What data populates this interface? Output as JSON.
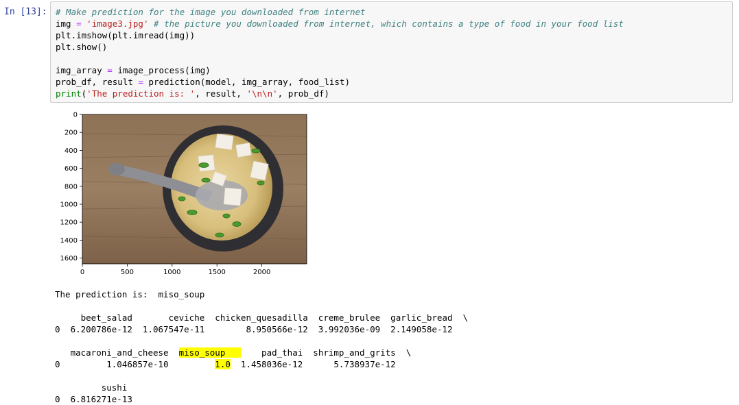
{
  "cell": {
    "prompt": "In [13]:",
    "code_lines": [
      {
        "segments": [
          {
            "t": "# Make prediction for the image you downloaded from internet",
            "c": "cm"
          }
        ]
      },
      {
        "segments": [
          {
            "t": "img ",
            "c": ""
          },
          {
            "t": "=",
            "c": "op"
          },
          {
            "t": " ",
            "c": ""
          },
          {
            "t": "'image3.jpg'",
            "c": "str"
          },
          {
            "t": " ",
            "c": ""
          },
          {
            "t": "# the picture you downloaded from internet, which contains a type of food in your food list",
            "c": "cm"
          }
        ]
      },
      {
        "segments": [
          {
            "t": "plt.imshow(plt.imread(img))",
            "c": ""
          }
        ]
      },
      {
        "segments": [
          {
            "t": "plt.show()",
            "c": ""
          }
        ]
      },
      {
        "segments": [
          {
            "t": "",
            "c": ""
          }
        ]
      },
      {
        "segments": [
          {
            "t": "img_array ",
            "c": ""
          },
          {
            "t": "=",
            "c": "op"
          },
          {
            "t": " image_process(img)",
            "c": ""
          }
        ]
      },
      {
        "segments": [
          {
            "t": "prob_df, result ",
            "c": ""
          },
          {
            "t": "=",
            "c": "op"
          },
          {
            "t": " prediction(model, img_array, food_list)",
            "c": ""
          }
        ]
      },
      {
        "segments": [
          {
            "t": "print",
            "c": "kw"
          },
          {
            "t": "(",
            "c": ""
          },
          {
            "t": "'The prediction is: '",
            "c": "str"
          },
          {
            "t": ", result, ",
            "c": ""
          },
          {
            "t": "'\\n\\n'",
            "c": "str"
          },
          {
            "t": ", prob_df)",
            "c": ""
          }
        ]
      }
    ]
  },
  "plot": {
    "image_description_icon": "miso-soup-photo",
    "x_ticks": [
      "0",
      "500",
      "1000",
      "1500",
      "2000"
    ],
    "y_ticks": [
      "0",
      "200",
      "400",
      "600",
      "800",
      "1000",
      "1200",
      "1400",
      "1600"
    ]
  },
  "output": {
    "prediction_line": "The prediction is:  miso_soup",
    "table1_header": "     beet_salad       ceviche  chicken_quesadilla  creme_brulee  garlic_bread  \\",
    "table1_row": "0  6.200786e-12  1.067547e-11        8.950566e-12  3.992036e-09  2.149058e-12",
    "table2_header_pre": "   macaroni_and_cheese  ",
    "table2_header_hl": "miso_soup   ",
    "table2_header_post": "    pad_thai  shrimp_and_grits  \\",
    "table2_row_pre": "0         1.046857e-10         ",
    "table2_row_hl": "1.0",
    "table2_row_post": "  1.458036e-12      5.738937e-12",
    "table3_header": "         sushi",
    "table3_row": "0  6.816271e-13"
  },
  "colors": {
    "highlight": "#ffff00",
    "cell_background": "#f7f7f7",
    "prompt": "#303f9f"
  }
}
